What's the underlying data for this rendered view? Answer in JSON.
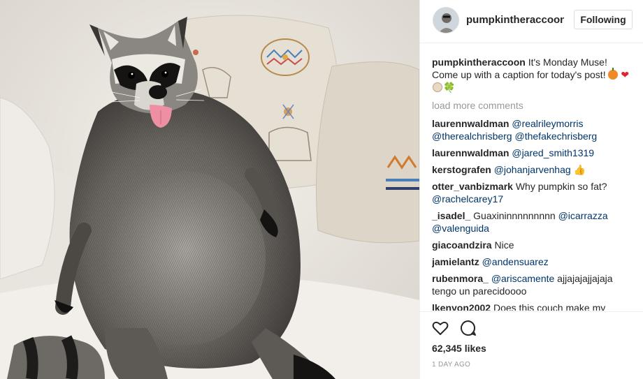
{
  "post": {
    "username": "pumpkintheraccoon",
    "follow_label": "Following",
    "caption_user": "pumpkintheraccoon",
    "caption_text_1": "It's Monday Muse! Come up with a caption for today's post!",
    "caption_hearts": "❤",
    "caption_clover": "🍀",
    "load_more": "load more comments",
    "likes": "62,345 likes",
    "time": "1 DAY AGO"
  },
  "comments": [
    {
      "user": "laurennwaldman",
      "parts": [
        {
          "m": "@realrileymorris"
        },
        {
          "t": " "
        },
        {
          "m": "@therealchrisberg"
        },
        {
          "t": " "
        },
        {
          "m": "@thefakechrisberg"
        }
      ]
    },
    {
      "user": "laurennwaldman",
      "parts": [
        {
          "m": "@jared_smith1319"
        }
      ]
    },
    {
      "user": "kerstografen",
      "parts": [
        {
          "m": "@johanjarvenhag"
        },
        {
          "t": " "
        },
        {
          "e": "👍"
        }
      ]
    },
    {
      "user": "otter_vanbizmark",
      "parts": [
        {
          "t": "Why pumpkin so fat? "
        },
        {
          "m": "@rachelcarey17"
        }
      ]
    },
    {
      "user": "_isadel_",
      "parts": [
        {
          "t": "Guaxininnnnnnnnn "
        },
        {
          "m": "@icarrazza"
        },
        {
          "t": " "
        },
        {
          "m": "@valenguida"
        }
      ]
    },
    {
      "user": "giacoandzira",
      "parts": [
        {
          "t": "Nice"
        }
      ]
    },
    {
      "user": "jamielantz",
      "parts": [
        {
          "m": "@andensuarez"
        }
      ]
    },
    {
      "user": "rubenmora_",
      "parts": [
        {
          "m": "@ariscamente"
        },
        {
          "t": " ajjajajajjajaja tengo un parecidoooo"
        }
      ]
    },
    {
      "user": "lkenyon2002",
      "parts": [
        {
          "t": "Does this couch make my"
        }
      ]
    }
  ],
  "icons": {
    "like": "heart-outline-icon",
    "comment": "speech-bubble-icon"
  },
  "colors": {
    "mention": "#003569",
    "muted": "#999999",
    "text": "#262626"
  }
}
